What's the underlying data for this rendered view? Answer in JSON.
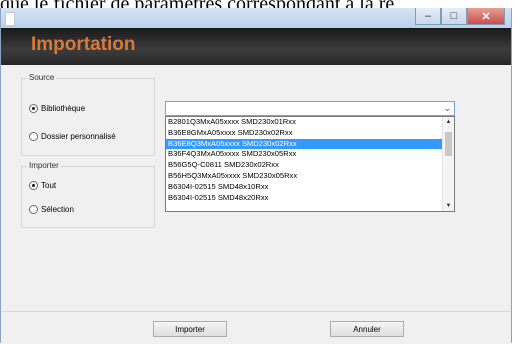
{
  "background_text": "que le fichier de paramètres correspondant à la ré",
  "window": {
    "controls": [
      "–",
      "□",
      "✕"
    ]
  },
  "header": {
    "title": "Importation",
    "title_color": "#d87a3c"
  },
  "source": {
    "label": "Source",
    "options": [
      {
        "label": "Bibliothèque",
        "selected": true
      },
      {
        "label": "Dossier personnalisé",
        "selected": false
      }
    ]
  },
  "importer": {
    "label": "Importer",
    "options": [
      {
        "label": "Tout",
        "selected": true
      },
      {
        "label": "Sélection",
        "selected": false
      }
    ]
  },
  "combo": {
    "value": "",
    "arrow": "⌄",
    "items": [
      "B2801Q3MxA05xxxx SMD230x01Rxx",
      "B36E8GMxA05xxxx SMD230x02Rxx",
      "B36E8Q3MxA05xxxx SMD230x02Rxx",
      "B36F4Q3MxA05xxxx SMD230x05Rxx",
      "B56G5Q-C0811 SMD230x02Rxx",
      "B56H5Q3MxA05xxxx SMD230x05Rxx",
      "B6304I-02515 SMD48x10Rxx",
      "B6304I-02515 SMD48x20Rxx"
    ],
    "selected_index": 2,
    "highlight_color": "#3399ff"
  },
  "buttons": {
    "import": "Importer",
    "cancel": "Annuler"
  }
}
